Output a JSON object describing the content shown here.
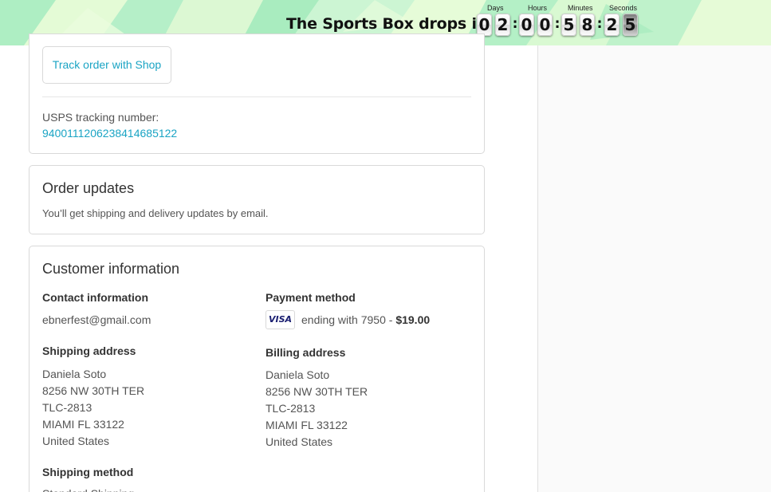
{
  "banner": {
    "title": "The Sports Box drops in",
    "labels": {
      "days": "Days",
      "hours": "Hours",
      "minutes": "Minutes",
      "seconds": "Seconds"
    },
    "countdown": {
      "d1": "0",
      "d2": "2",
      "h1": "0",
      "h2": "0",
      "m1": "5",
      "m2": "8",
      "s1": "2",
      "s2": "5"
    },
    "separator": ":",
    "colors": {
      "background": "#c8f3d4",
      "shape_light": "#e8fbd8",
      "shape_mint": "#a9ecc0"
    }
  },
  "tracking": {
    "button_label": "Track order with Shop",
    "carrier_label": "USPS tracking number:",
    "tracking_number": "9400111206238414685122"
  },
  "updates": {
    "title": "Order updates",
    "text": "You’ll get shipping and delivery updates by email."
  },
  "customer": {
    "title": "Customer information",
    "contact": {
      "heading": "Contact information",
      "email": "ebnerfest@gmail.com"
    },
    "payment": {
      "heading": "Payment method",
      "card_brand": "VISA",
      "ending_text": "ending with 7950",
      "separator": " - ",
      "amount": "$19.00"
    },
    "shipping_address": {
      "heading": "Shipping address",
      "lines": [
        "Daniela Soto",
        "8256 NW 30TH TER",
        "TLC-2813",
        "MIAMI FL 33122",
        "United States"
      ]
    },
    "billing_address": {
      "heading": "Billing address",
      "lines": [
        "Daniela Soto",
        "8256 NW 30TH TER",
        "TLC-2813",
        "MIAMI FL 33122",
        "United States"
      ]
    },
    "shipping_method": {
      "heading": "Shipping method",
      "value": "Standard Shipping"
    }
  },
  "colors": {
    "accent_link": "#1aa4c4",
    "text": "#545454",
    "heading": "#333333",
    "border": "#d9d9d9",
    "sidebar_bg": "#fafafa"
  }
}
